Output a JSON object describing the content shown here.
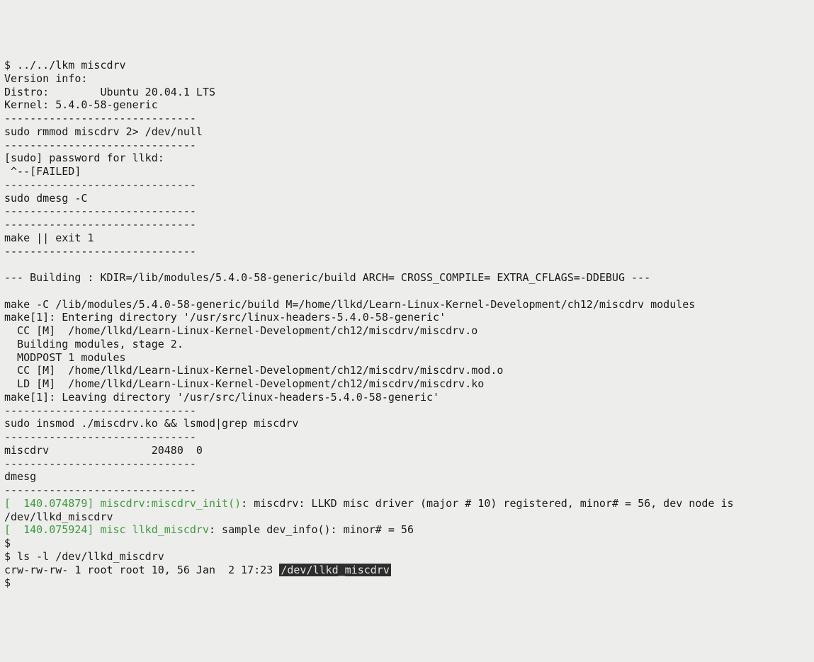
{
  "lines": [
    {
      "parts": [
        {
          "t": "$ ../../lkm miscdrv"
        }
      ]
    },
    {
      "parts": [
        {
          "t": "Version info:"
        }
      ]
    },
    {
      "parts": [
        {
          "t": "Distro:        Ubuntu 20.04.1 LTS"
        }
      ]
    },
    {
      "parts": [
        {
          "t": "Kernel: 5.4.0-58-generic"
        }
      ]
    },
    {
      "parts": [
        {
          "t": "------------------------------"
        }
      ]
    },
    {
      "parts": [
        {
          "t": "sudo rmmod miscdrv 2> /dev/null"
        }
      ]
    },
    {
      "parts": [
        {
          "t": "------------------------------"
        }
      ]
    },
    {
      "parts": [
        {
          "t": "[sudo] password for llkd: "
        }
      ]
    },
    {
      "parts": [
        {
          "t": " ^--[FAILED]"
        }
      ]
    },
    {
      "parts": [
        {
          "t": "------------------------------"
        }
      ]
    },
    {
      "parts": [
        {
          "t": "sudo dmesg -C"
        }
      ]
    },
    {
      "parts": [
        {
          "t": "------------------------------"
        }
      ]
    },
    {
      "parts": [
        {
          "t": "------------------------------"
        }
      ]
    },
    {
      "parts": [
        {
          "t": "make || exit 1"
        }
      ]
    },
    {
      "parts": [
        {
          "t": "------------------------------"
        }
      ]
    },
    {
      "parts": [
        {
          "t": ""
        }
      ]
    },
    {
      "parts": [
        {
          "t": "--- Building : KDIR=/lib/modules/5.4.0-58-generic/build ARCH= CROSS_COMPILE= EXTRA_CFLAGS=-DDEBUG ---"
        }
      ]
    },
    {
      "parts": [
        {
          "t": ""
        }
      ]
    },
    {
      "parts": [
        {
          "t": "make -C /lib/modules/5.4.0-58-generic/build M=/home/llkd/Learn-Linux-Kernel-Development/ch12/miscdrv modules"
        }
      ]
    },
    {
      "parts": [
        {
          "t": "make[1]: Entering directory '/usr/src/linux-headers-5.4.0-58-generic'"
        }
      ]
    },
    {
      "parts": [
        {
          "t": "  CC [M]  /home/llkd/Learn-Linux-Kernel-Development/ch12/miscdrv/miscdrv.o"
        }
      ]
    },
    {
      "parts": [
        {
          "t": "  Building modules, stage 2."
        }
      ]
    },
    {
      "parts": [
        {
          "t": "  MODPOST 1 modules"
        }
      ]
    },
    {
      "parts": [
        {
          "t": "  CC [M]  /home/llkd/Learn-Linux-Kernel-Development/ch12/miscdrv/miscdrv.mod.o"
        }
      ]
    },
    {
      "parts": [
        {
          "t": "  LD [M]  /home/llkd/Learn-Linux-Kernel-Development/ch12/miscdrv/miscdrv.ko"
        }
      ]
    },
    {
      "parts": [
        {
          "t": "make[1]: Leaving directory '/usr/src/linux-headers-5.4.0-58-generic'"
        }
      ]
    },
    {
      "parts": [
        {
          "t": "------------------------------"
        }
      ]
    },
    {
      "parts": [
        {
          "t": "sudo insmod ./miscdrv.ko && lsmod|grep miscdrv"
        }
      ]
    },
    {
      "parts": [
        {
          "t": "------------------------------"
        }
      ]
    },
    {
      "parts": [
        {
          "t": "miscdrv                20480  0"
        }
      ]
    },
    {
      "parts": [
        {
          "t": "------------------------------"
        }
      ]
    },
    {
      "parts": [
        {
          "t": "dmesg"
        }
      ]
    },
    {
      "parts": [
        {
          "t": "------------------------------"
        }
      ]
    },
    {
      "parts": [
        {
          "t": "[  140.074879] ",
          "cls": "green"
        },
        {
          "t": "miscdrv:miscdrv_init()",
          "cls": "green"
        },
        {
          "t": ": miscdrv: LLKD misc driver (major # 10) registered, minor# = 56, dev node is "
        }
      ]
    },
    {
      "parts": [
        {
          "t": "/dev/llkd_miscdrv"
        }
      ]
    },
    {
      "parts": [
        {
          "t": "[  140.075924] ",
          "cls": "green"
        },
        {
          "t": "misc llkd_miscdrv",
          "cls": "green"
        },
        {
          "t": ": sample dev_info(): minor# = 56"
        }
      ]
    },
    {
      "parts": [
        {
          "t": "$ "
        }
      ]
    },
    {
      "parts": [
        {
          "t": "$ ls -l /dev/llkd_miscdrv"
        }
      ]
    },
    {
      "parts": [
        {
          "t": "crw-rw-rw- 1 root root 10, 56 Jan  2 17:23 "
        },
        {
          "t": "/dev/llkd_miscdrv",
          "cls": "hl"
        }
      ]
    },
    {
      "parts": [
        {
          "t": "$ "
        }
      ]
    }
  ]
}
